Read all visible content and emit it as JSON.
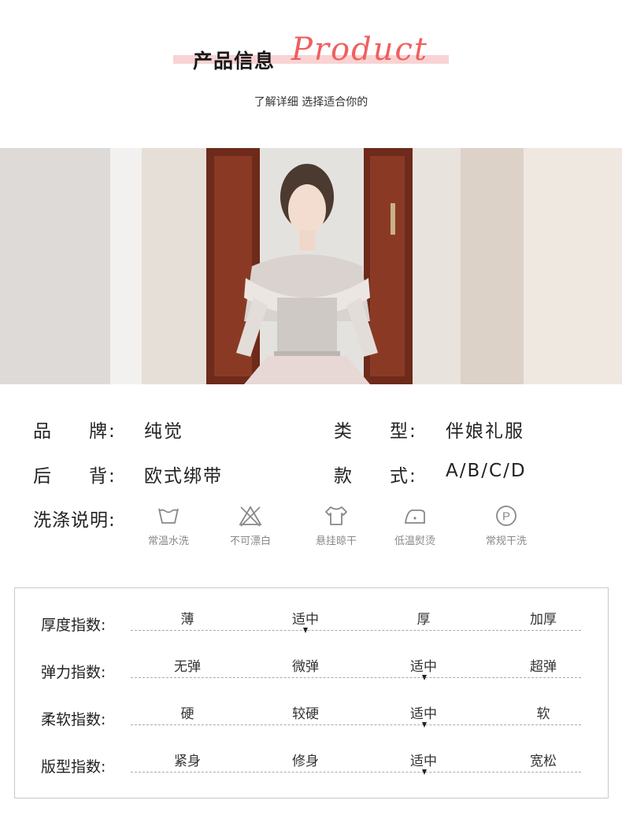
{
  "header": {
    "title_cn": "产品信息",
    "title_en": "Product",
    "subtitle": "了解详细 选择适合你的"
  },
  "product_photo": {
    "alt": "product-photo"
  },
  "info": {
    "brand": {
      "label_1": "品",
      "label_2": "牌",
      "colon": ":",
      "value": "纯觉"
    },
    "type": {
      "label_1": "类",
      "label_2": "型",
      "colon": ":",
      "value": "伴娘礼服"
    },
    "back": {
      "label_1": "后",
      "label_2": "背",
      "colon": ":",
      "value": "欧式绑带"
    },
    "style": {
      "label_1": "款",
      "label_2": "式",
      "colon": ":",
      "value": "A/B/C/D"
    },
    "care": {
      "label": "洗涤说明:",
      "items": [
        {
          "icon": "wash-basin-icon",
          "label": "常温水洗"
        },
        {
          "icon": "no-bleach-icon",
          "label": "不可漂白"
        },
        {
          "icon": "hang-dry-icon",
          "label": "悬挂晾干"
        },
        {
          "icon": "low-iron-icon",
          "label": "低温熨烫"
        },
        {
          "icon": "dry-clean-p-icon",
          "label": "常规干洗",
          "symbol": "P"
        }
      ]
    }
  },
  "indices": [
    {
      "label": "厚度指数:",
      "options": [
        "薄",
        "适中",
        "厚",
        "加厚"
      ],
      "selected": 1
    },
    {
      "label": "弹力指数:",
      "options": [
        "无弹",
        "微弹",
        "适中",
        "超弹"
      ],
      "selected": 2
    },
    {
      "label": "柔软指数:",
      "options": [
        "硬",
        "较硬",
        "适中",
        "软"
      ],
      "selected": 2
    },
    {
      "label": "版型指数:",
      "options": [
        "紧身",
        "修身",
        "适中",
        "宽松"
      ],
      "selected": 2
    }
  ],
  "colors": {
    "accent": "#ef5f5f",
    "accent_bar": "#f9d3d3",
    "care_icon": "#888888"
  }
}
